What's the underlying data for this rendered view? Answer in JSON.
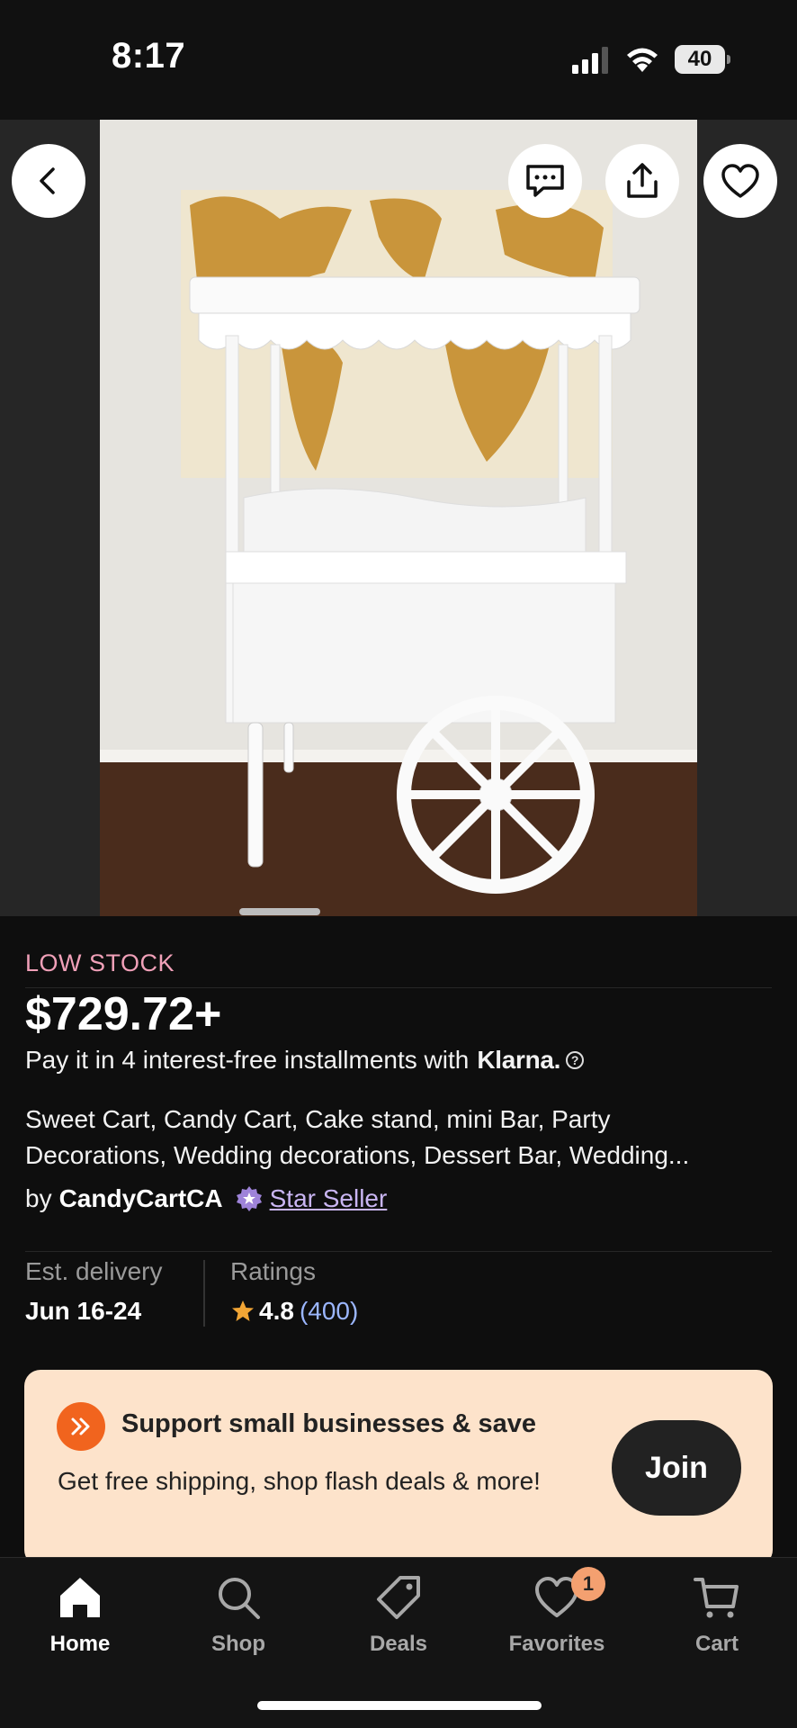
{
  "status_bar": {
    "time": "8:17",
    "battery": "40"
  },
  "product": {
    "stock_label": "LOW STOCK",
    "price": "$729.72+",
    "installments_text": "Pay it in 4 interest-free installments with",
    "klarna": "Klarna.",
    "help_symbol": "?",
    "title_line1": "Sweet Cart, Candy Cart, Cake stand, mini Bar, Party",
    "title_line2": "Decorations, Wedding decorations, Dessert Bar, Wedding...",
    "seller_by": "by",
    "seller_name": "CandyCartCA",
    "star_seller_label": "Star Seller",
    "delivery_label": "Est. delivery",
    "delivery_value": "Jun 16-24",
    "ratings_label": "Ratings",
    "rating_value": "4.8",
    "rating_count": "(400)"
  },
  "promo": {
    "title": "Support small businesses & save",
    "text": "Get free shipping, shop flash deals & more!",
    "join_label": "Join"
  },
  "tabs": [
    {
      "label": "Home",
      "icon": "home-icon",
      "active": true
    },
    {
      "label": "Shop",
      "icon": "search-icon"
    },
    {
      "label": "Deals",
      "icon": "tag-icon"
    },
    {
      "label": "Favorites",
      "icon": "heart-icon",
      "badge": "1"
    },
    {
      "label": "Cart",
      "icon": "cart-icon"
    }
  ],
  "colors": {
    "background": "#0e0e0e",
    "low_stock": "#f0a0b8",
    "star_seller": "#c9b5f2",
    "promo_bg": "#fde3cb",
    "promo_icon": "#f1641e",
    "badge": "#f4a070",
    "rating_count": "#9bb6ff"
  }
}
